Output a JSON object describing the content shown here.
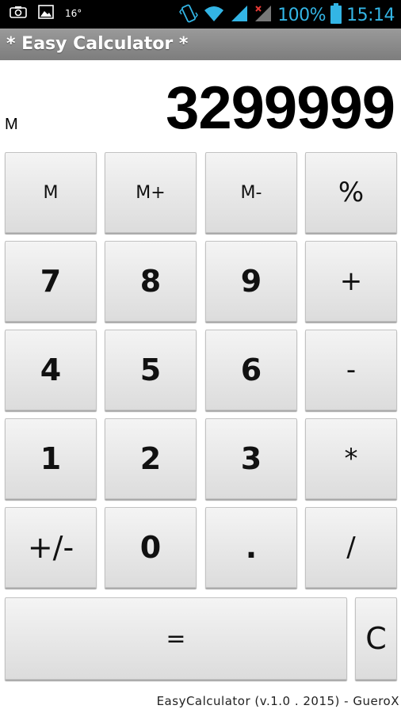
{
  "status_bar": {
    "temperature": "16°",
    "battery_percent": "100%",
    "time": "15:14",
    "accent_color": "#33b5e5",
    "icons": [
      "screenshot-icon",
      "image-icon",
      "vibrate-icon",
      "wifi-icon",
      "signal-icon",
      "signal-no-data-icon",
      "battery-icon"
    ]
  },
  "title_bar": {
    "title": "* Easy Calculator *"
  },
  "display": {
    "memory_indicator": "M",
    "value": "3299999"
  },
  "keypad": {
    "m": "M",
    "m_plus": "M+",
    "m_minus": "M-",
    "percent": "%",
    "seven": "7",
    "eight": "8",
    "nine": "9",
    "plus": "+",
    "four": "4",
    "five": "5",
    "six": "6",
    "minus": "-",
    "one": "1",
    "two": "2",
    "three": "3",
    "multiply": "*",
    "plus_minus": "+/-",
    "zero": "0",
    "decimal": ".",
    "divide": "/",
    "equals": "=",
    "clear": "C"
  },
  "footer": {
    "text": "EasyCalculator (v.1.0 . 2015) -  GueroX"
  }
}
